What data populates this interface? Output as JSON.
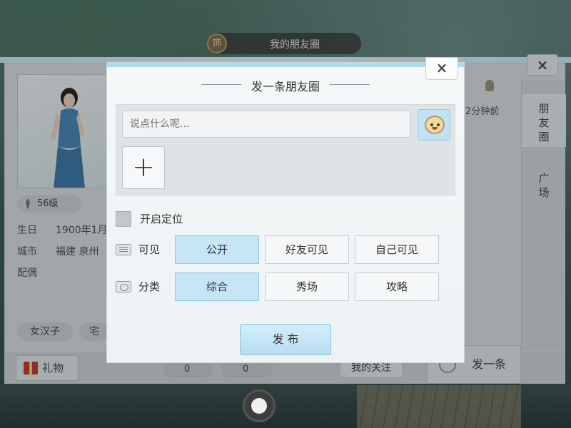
{
  "top_bar": {
    "badge": "饰",
    "title": "我的朋友圈"
  },
  "profile": {
    "level": "56级",
    "birthday_label": "生日",
    "birthday_value": "1900年1月",
    "city_label": "城市",
    "city_value": "福建 泉州",
    "spouse_label": "配偶",
    "tags": [
      "女汉子",
      "宅"
    ]
  },
  "feed": {
    "time": "2分钟前"
  },
  "side_tabs": [
    {
      "label": "朋\n友\n圈",
      "active": true
    },
    {
      "label": "广\n场",
      "active": false
    }
  ],
  "bottom_bar": {
    "gift_label": "礼物",
    "like_count": "0",
    "flower_count": "0",
    "follow_label": "我的关注",
    "post_label": "发一条"
  },
  "modal": {
    "title": "发一条朋友圈",
    "close_glyph": "×",
    "input_placeholder": "说点什么呢...",
    "add_glyph": "+",
    "location_label": "开启定位",
    "visibility": {
      "label": "可见",
      "options": [
        "公开",
        "好友可见",
        "自己可见"
      ],
      "selected": "公开"
    },
    "category": {
      "label": "分类",
      "options": [
        "综合",
        "秀场",
        "攻略"
      ],
      "selected": "综合"
    },
    "publish_label": "发 布"
  },
  "colors": {
    "accent_selected": "#c6e6f6",
    "modal_border": "#a9dcef"
  }
}
